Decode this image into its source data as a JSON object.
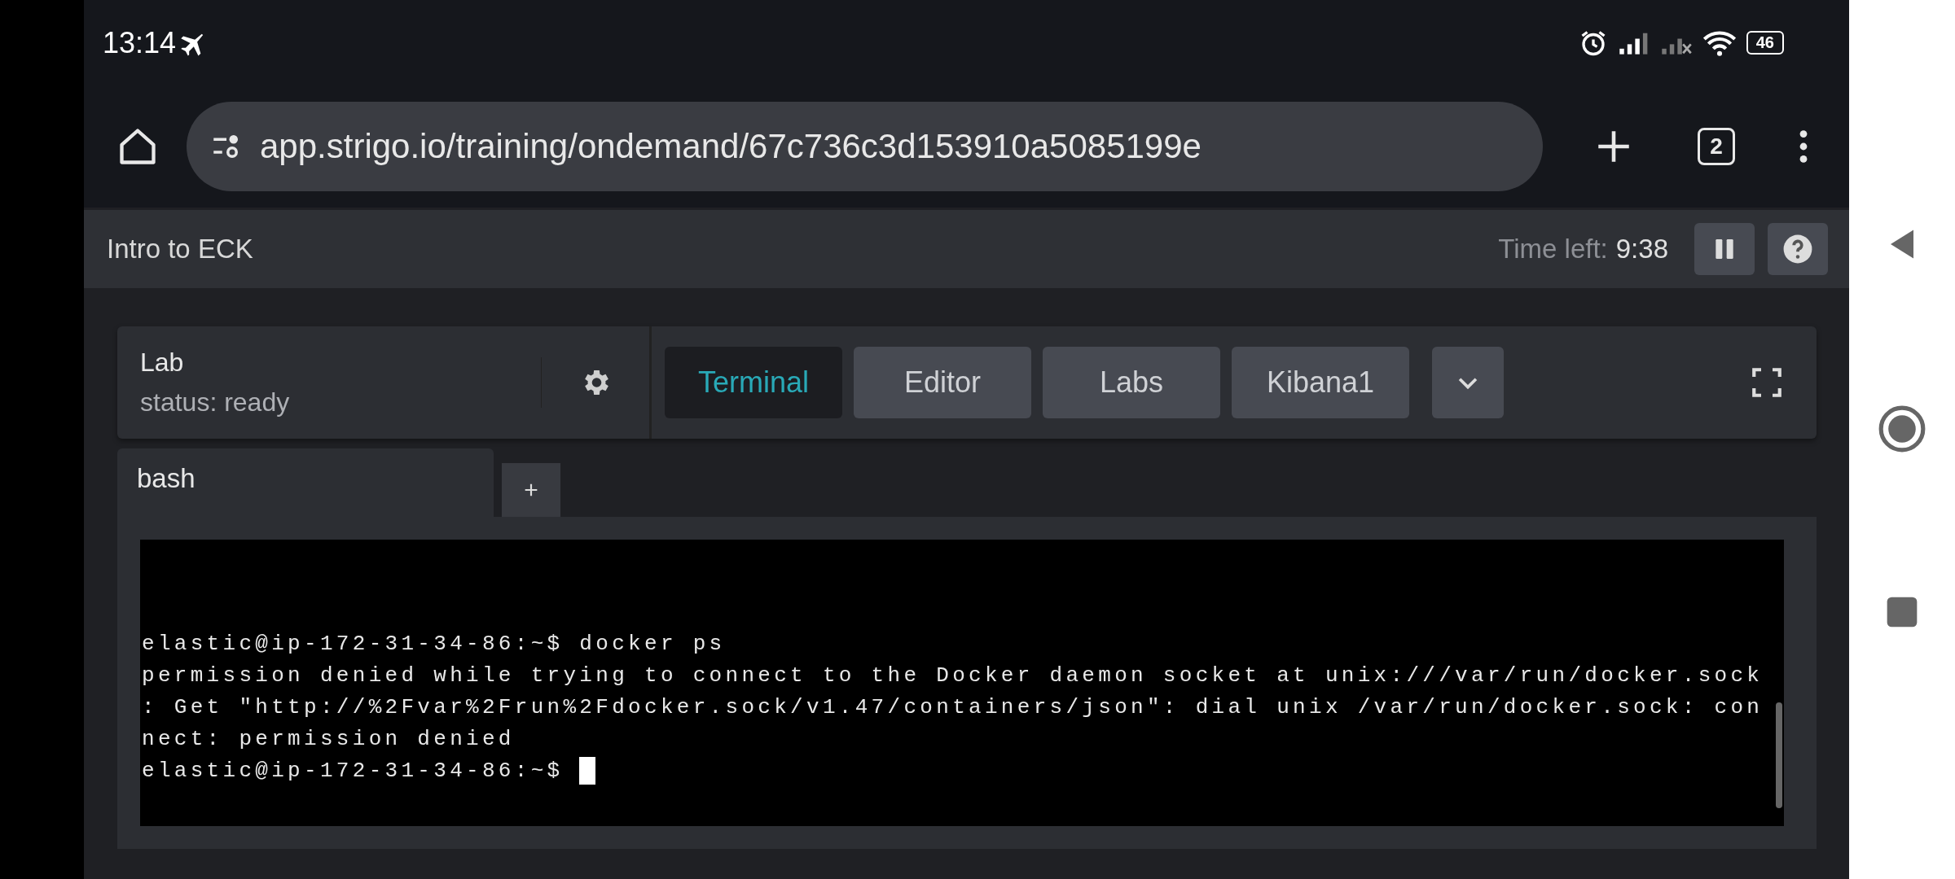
{
  "status_bar": {
    "time": "13:14",
    "battery": "46"
  },
  "browser": {
    "url": "app.strigo.io/training/ondemand/67c736c3d153910a5085199e",
    "tab_count": "2"
  },
  "header": {
    "title": "Intro to ECK",
    "time_left_label": "Time left:",
    "time_left": "9:38"
  },
  "lab": {
    "name": "Lab",
    "status": "status: ready"
  },
  "tabs": [
    {
      "label": "Terminal",
      "selected": true
    },
    {
      "label": "Editor",
      "selected": false
    },
    {
      "label": "Labs",
      "selected": false
    },
    {
      "label": "Kibana1",
      "selected": false
    }
  ],
  "sessions": [
    {
      "label": "bash",
      "selected": true
    }
  ],
  "terminal": {
    "lines": [
      "elastic@ip-172-31-34-86:~$ docker ps",
      "permission denied while trying to connect to the Docker daemon socket at unix:///var/run/docker.sock",
      ": Get \"http://%2Fvar%2Frun%2Fdocker.sock/v1.47/containers/json\": dial unix /var/run/docker.sock: con",
      "nect: permission denied",
      "elastic@ip-172-31-34-86:~$ "
    ]
  }
}
